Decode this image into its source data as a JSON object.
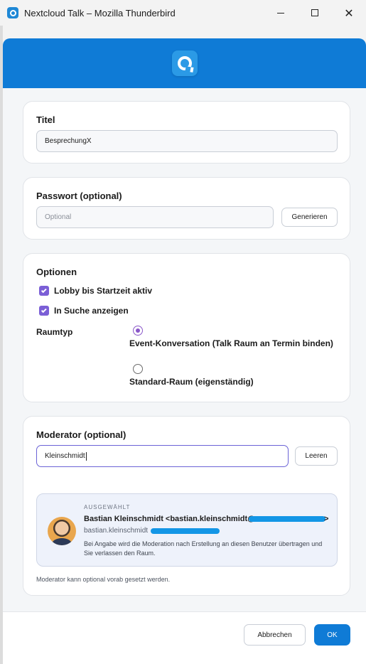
{
  "window": {
    "title": "Nextcloud Talk – Mozilla Thunderbird",
    "controls": {
      "minimize": "minimize",
      "maximize": "maximize",
      "close": "✕"
    }
  },
  "colors": {
    "accent": "#0f7bd6",
    "checkbox": "#7b5fd6",
    "radio": "#8a57c9"
  },
  "title_card": {
    "heading": "Titel",
    "value": "BesprechungX"
  },
  "password_card": {
    "heading": "Passwort (optional)",
    "placeholder": "Optional",
    "generate_label": "Generieren"
  },
  "options_card": {
    "heading": "Optionen",
    "checkboxes": [
      {
        "label": "Lobby bis Startzeit aktiv",
        "checked": true
      },
      {
        "label": "In Suche anzeigen",
        "checked": true
      }
    ],
    "room_type_label": "Raumtyp",
    "room_types": [
      {
        "label": "Event-Konversation (Talk Raum an Termin binden)",
        "selected": true
      },
      {
        "label": "Standard-Raum (eigenständig)",
        "selected": false
      }
    ]
  },
  "moderator_card": {
    "heading": "Moderator (optional)",
    "value": "Kleinschmidt",
    "clear_label": "Leeren",
    "selected": {
      "caption": "AUSGEWÄHLT",
      "name": "Bastian Kleinschmidt <bastian.kleinschmidt@",
      "name_end": ">",
      "username": "bastian.kleinschmidt",
      "note": "Bei Angabe wird die Moderation nach Erstellung an diesen Benutzer übertragen und Sie verlassen den Raum."
    },
    "hint": "Moderator kann optional vorab gesetzt werden."
  },
  "footer": {
    "cancel_label": "Abbrechen",
    "ok_label": "OK"
  }
}
